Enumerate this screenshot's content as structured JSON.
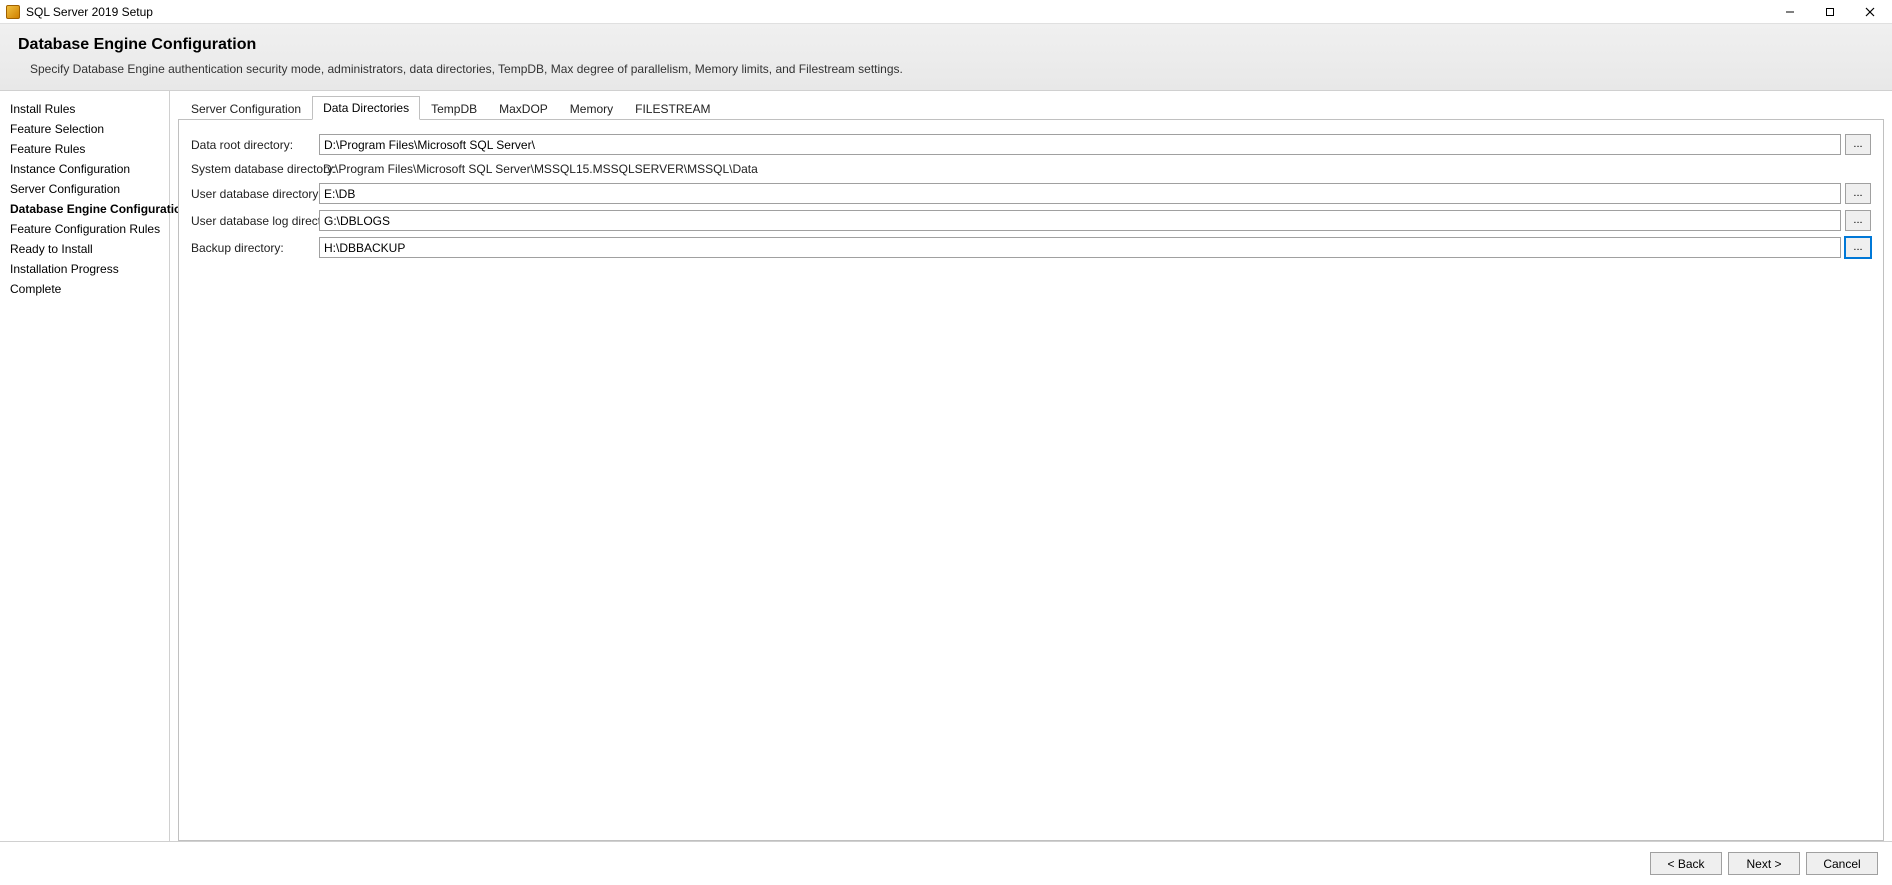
{
  "window": {
    "title": "SQL Server 2019 Setup"
  },
  "header": {
    "title": "Database Engine Configuration",
    "subtitle": "Specify Database Engine authentication security mode, administrators, data directories, TempDB, Max degree of parallelism, Memory limits, and Filestream settings."
  },
  "sidebar": {
    "steps": [
      {
        "label": "Install Rules",
        "active": false
      },
      {
        "label": "Feature Selection",
        "active": false
      },
      {
        "label": "Feature Rules",
        "active": false
      },
      {
        "label": "Instance Configuration",
        "active": false
      },
      {
        "label": "Server Configuration",
        "active": false
      },
      {
        "label": "Database Engine Configuration",
        "active": true
      },
      {
        "label": "Feature Configuration Rules",
        "active": false
      },
      {
        "label": "Ready to Install",
        "active": false
      },
      {
        "label": "Installation Progress",
        "active": false
      },
      {
        "label": "Complete",
        "active": false
      }
    ]
  },
  "tabs": {
    "items": [
      "Server Configuration",
      "Data Directories",
      "TempDB",
      "MaxDOP",
      "Memory",
      "FILESTREAM"
    ],
    "active_index": 1
  },
  "form": {
    "data_root_label": "Data root directory:",
    "data_root_value": "D:\\Program Files\\Microsoft SQL Server\\",
    "system_db_label": "System database directory:",
    "system_db_value": "D:\\Program Files\\Microsoft SQL Server\\MSSQL15.MSSQLSERVER\\MSSQL\\Data",
    "user_db_label": "User database directory:",
    "user_db_value": "E:\\DB",
    "user_db_log_label": "User database log directory:",
    "user_db_log_value": "G:\\DBLOGS",
    "backup_label": "Backup directory:",
    "backup_value": "H:\\DBBACKUP",
    "browse_label": "..."
  },
  "footer": {
    "back": "< Back",
    "next": "Next >",
    "cancel": "Cancel"
  }
}
